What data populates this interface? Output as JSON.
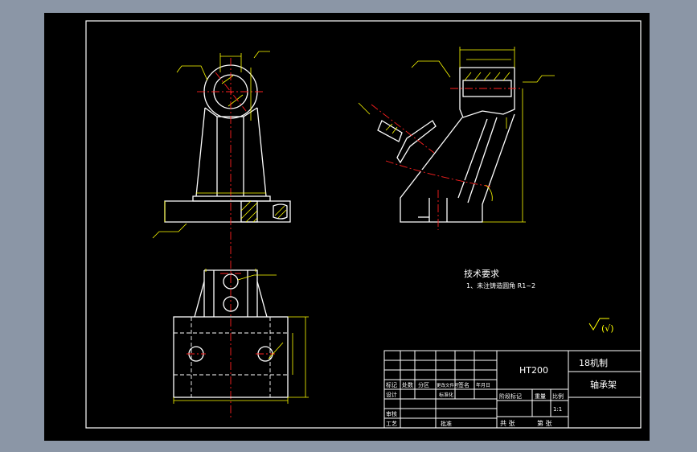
{
  "colors": {
    "background": "#8b96a6",
    "sheet": "#000000",
    "line": "#ffffff",
    "dimension": "#ffff00",
    "centerline": "#ff2020"
  },
  "notes": {
    "heading": "技术要求",
    "item1": "1、未注铸造圆角 R1~2",
    "surface_symbol": "(√)"
  },
  "title_block": {
    "material": "HT200",
    "school": "18机制",
    "part_name": "轴承架",
    "h_mark": "标记",
    "h_count": "处数",
    "h_zone": "分区",
    "h_docno": "更改文件号",
    "h_sign": "签名",
    "h_date": "年月日",
    "h_design": "设计",
    "h_std": "标准化",
    "h_stage": "阶段标记",
    "h_weight": "重量",
    "h_scale": "比例",
    "scale_value": "1:1",
    "h_review": "审核",
    "h_process": "工艺",
    "h_approve": "批准",
    "total_sheets": "共  张",
    "sheet_no": "第  张"
  }
}
